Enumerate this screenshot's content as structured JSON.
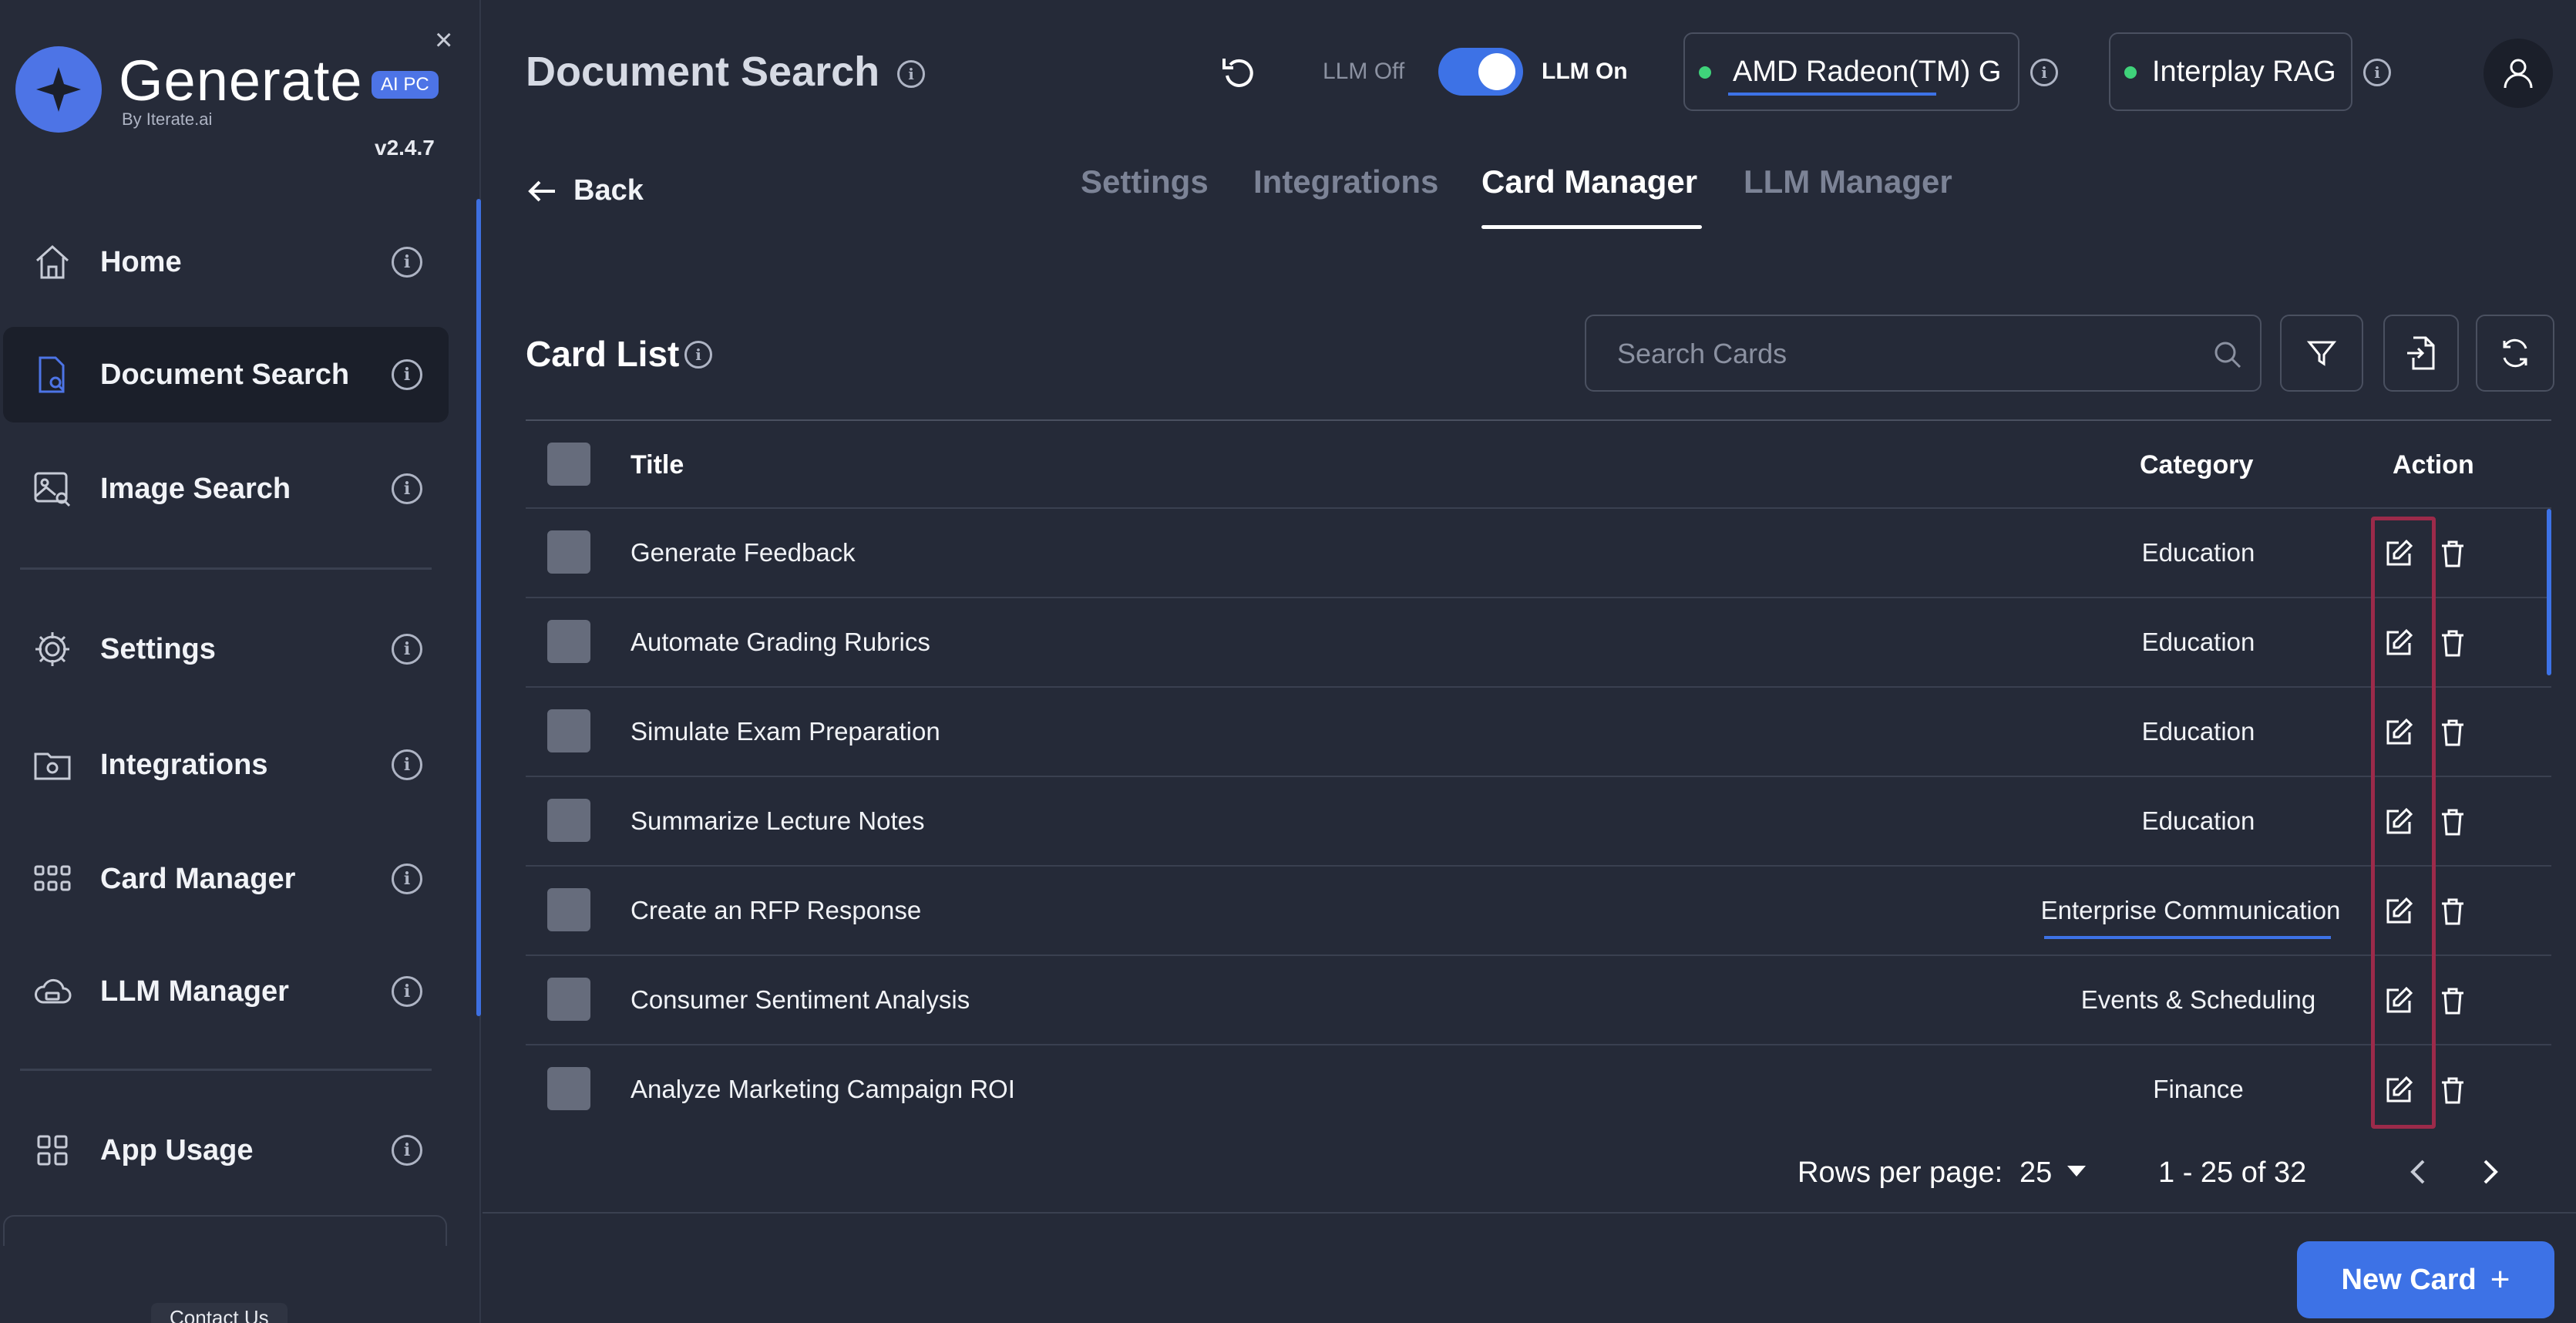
{
  "sidebar": {
    "logo_text": "Generate",
    "logo_sub": "By Iterate.ai",
    "badge": "AI PC",
    "close_symbol": "×",
    "version": "v2.4.7",
    "items": [
      {
        "label": "Home",
        "icon": "home-icon"
      },
      {
        "label": "Document Search",
        "icon": "document-search-icon"
      },
      {
        "label": "Image Search",
        "icon": "image-search-icon"
      },
      {
        "label": "Settings",
        "icon": "gear-icon"
      },
      {
        "label": "Integrations",
        "icon": "integrations-icon"
      },
      {
        "label": "Card Manager",
        "icon": "grid-icon"
      },
      {
        "label": "LLM Manager",
        "icon": "cloud-icon"
      },
      {
        "label": "App Usage",
        "icon": "apps-icon"
      }
    ],
    "info_glyph": "i",
    "contact": "Contact Us"
  },
  "header": {
    "title": "Document Search",
    "llm_off": "LLM Off",
    "llm_on": "LLM On",
    "gpu_label": "AMD Radeon(TM) G",
    "rag_label": "Interplay RAG"
  },
  "nav": {
    "back": "Back",
    "tabs": [
      "Settings",
      "Integrations",
      "Card Manager",
      "LLM Manager"
    ],
    "active_tab": "Card Manager"
  },
  "card_list": {
    "title": "Card List",
    "search_placeholder": "Search Cards",
    "columns": {
      "title": "Title",
      "category": "Category",
      "action": "Action"
    },
    "rows": [
      {
        "title": "Generate Feedback",
        "category": "Education"
      },
      {
        "title": "Automate Grading Rubrics",
        "category": "Education"
      },
      {
        "title": "Simulate Exam Preparation",
        "category": "Education"
      },
      {
        "title": "Summarize Lecture Notes",
        "category": "Education"
      },
      {
        "title": "Create an RFP Response",
        "category": "Enterprise Communication"
      },
      {
        "title": "Consumer Sentiment Analysis",
        "category": "Events & Scheduling"
      },
      {
        "title": "Analyze Marketing Campaign ROI",
        "category": "Finance"
      }
    ]
  },
  "pagination": {
    "rows_label": "Rows per page:",
    "rows_value": "25",
    "range": "1 - 25 of 32"
  },
  "actions": {
    "new_card": "New Card",
    "new_card_symbol": "+"
  },
  "colors": {
    "background": "#252a38",
    "accent": "#3d72e6",
    "status_green": "#3fd27a",
    "highlight": "#9c2a4a"
  }
}
